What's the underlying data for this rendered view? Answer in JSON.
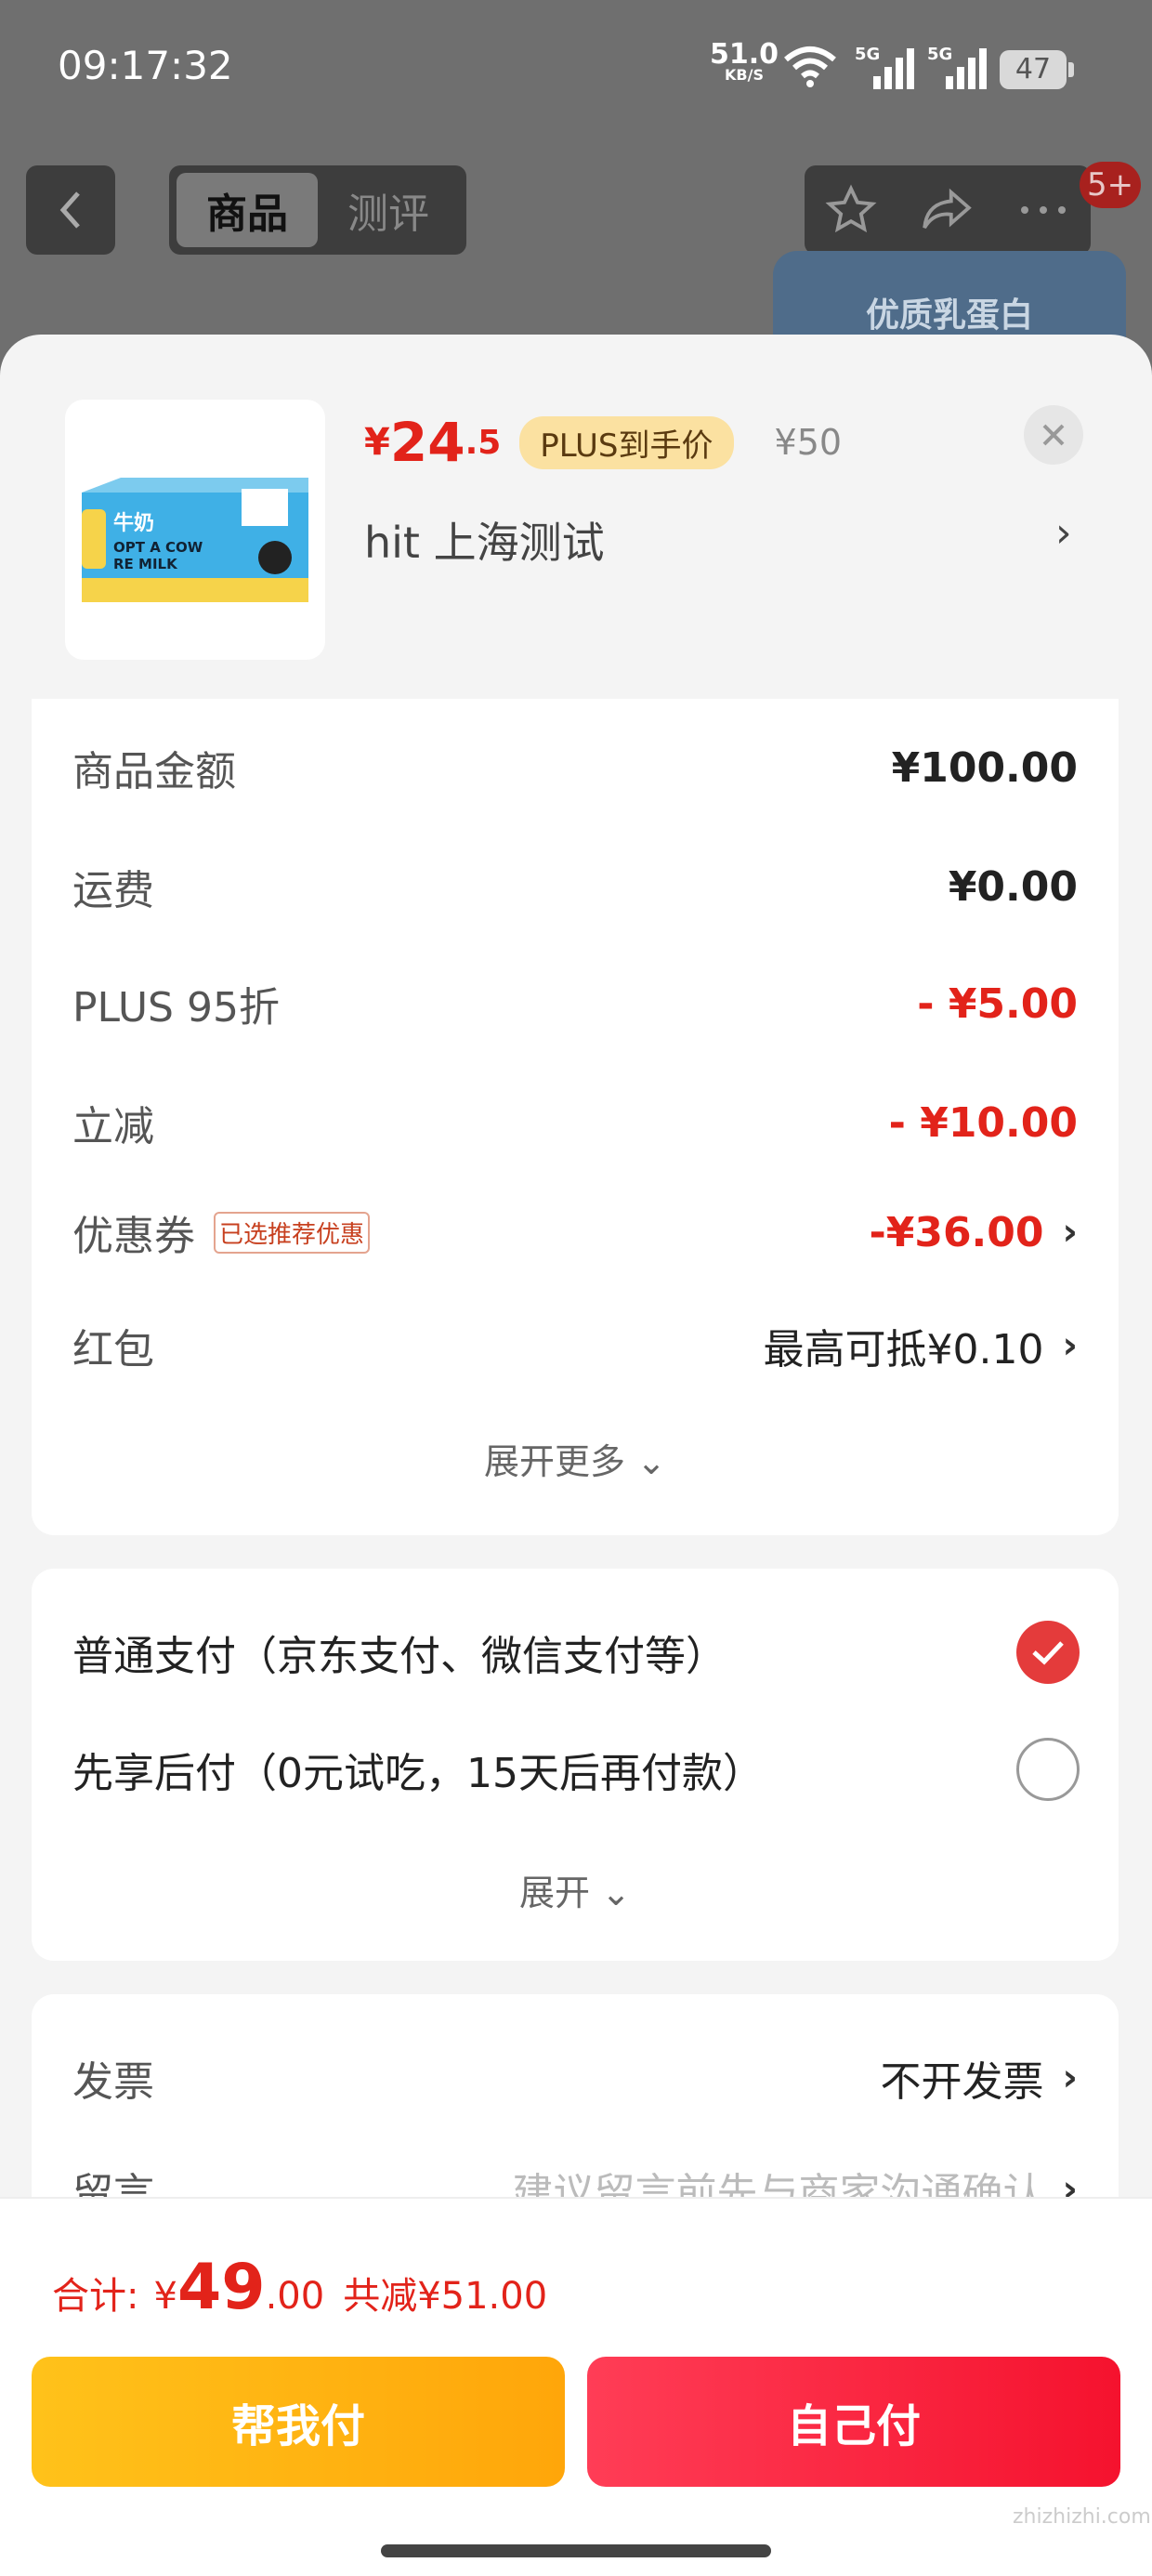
{
  "status_bar": {
    "time": "09:17:32",
    "net_speed": "51.0",
    "net_unit": "KB/S",
    "sig1_label": "5G",
    "sig2_label": "5G",
    "battery": "47"
  },
  "header": {
    "tabs": [
      {
        "label": "商品",
        "active": true
      },
      {
        "label": "测评",
        "active": false
      }
    ],
    "badge": "5+",
    "promo_text": "优质乳蛋白"
  },
  "sheet": {
    "product_image_text": [
      "牛奶",
      "OPT A COW",
      "RE MILK"
    ],
    "price": {
      "currency": "¥",
      "integer": "24",
      "decimal": ".5",
      "plus_tag": "PLUS到手价",
      "original": "¥50"
    },
    "address": "hit  上海测试",
    "summary_rows": [
      {
        "label": "商品金额",
        "value": "¥100.00",
        "red": false
      },
      {
        "label": "运费",
        "value": "¥0.00",
        "red": false
      },
      {
        "label": "PLUS 95折",
        "value": "- ¥5.00",
        "red": true
      },
      {
        "label": "立减",
        "value": "- ¥10.00",
        "red": true
      }
    ],
    "coupon": {
      "label": "优惠券",
      "tag": "已选推荐优惠",
      "value": "-¥36.00"
    },
    "red_packet": {
      "label": "红包",
      "value": "最高可抵¥0.10"
    },
    "expand_more": "展开更多",
    "payment": {
      "options": [
        {
          "label": "普通支付（京东支付、微信支付等）",
          "selected": true
        },
        {
          "label": "先享后付（0元试吃，15天后再付款）",
          "selected": false
        }
      ],
      "expand": "展开"
    },
    "invoice": {
      "label": "发票",
      "value": "不开发票"
    },
    "message": {
      "label": "留言",
      "placeholder": "建议留言前先与商家沟通确认"
    }
  },
  "footer": {
    "total_label": "合计:",
    "currency": "¥",
    "total_integer": "49",
    "total_decimal": ".00",
    "saved": "共减¥51.00",
    "help_pay_label": "帮我付",
    "self_pay_label": "自己付",
    "watermark": "zhizhizhi.com"
  },
  "colors": {
    "accent_red": "#e2231a",
    "plus_gold": "#fbe1a1",
    "help_btn": "#ffb210",
    "self_btn": "#f5122e"
  }
}
